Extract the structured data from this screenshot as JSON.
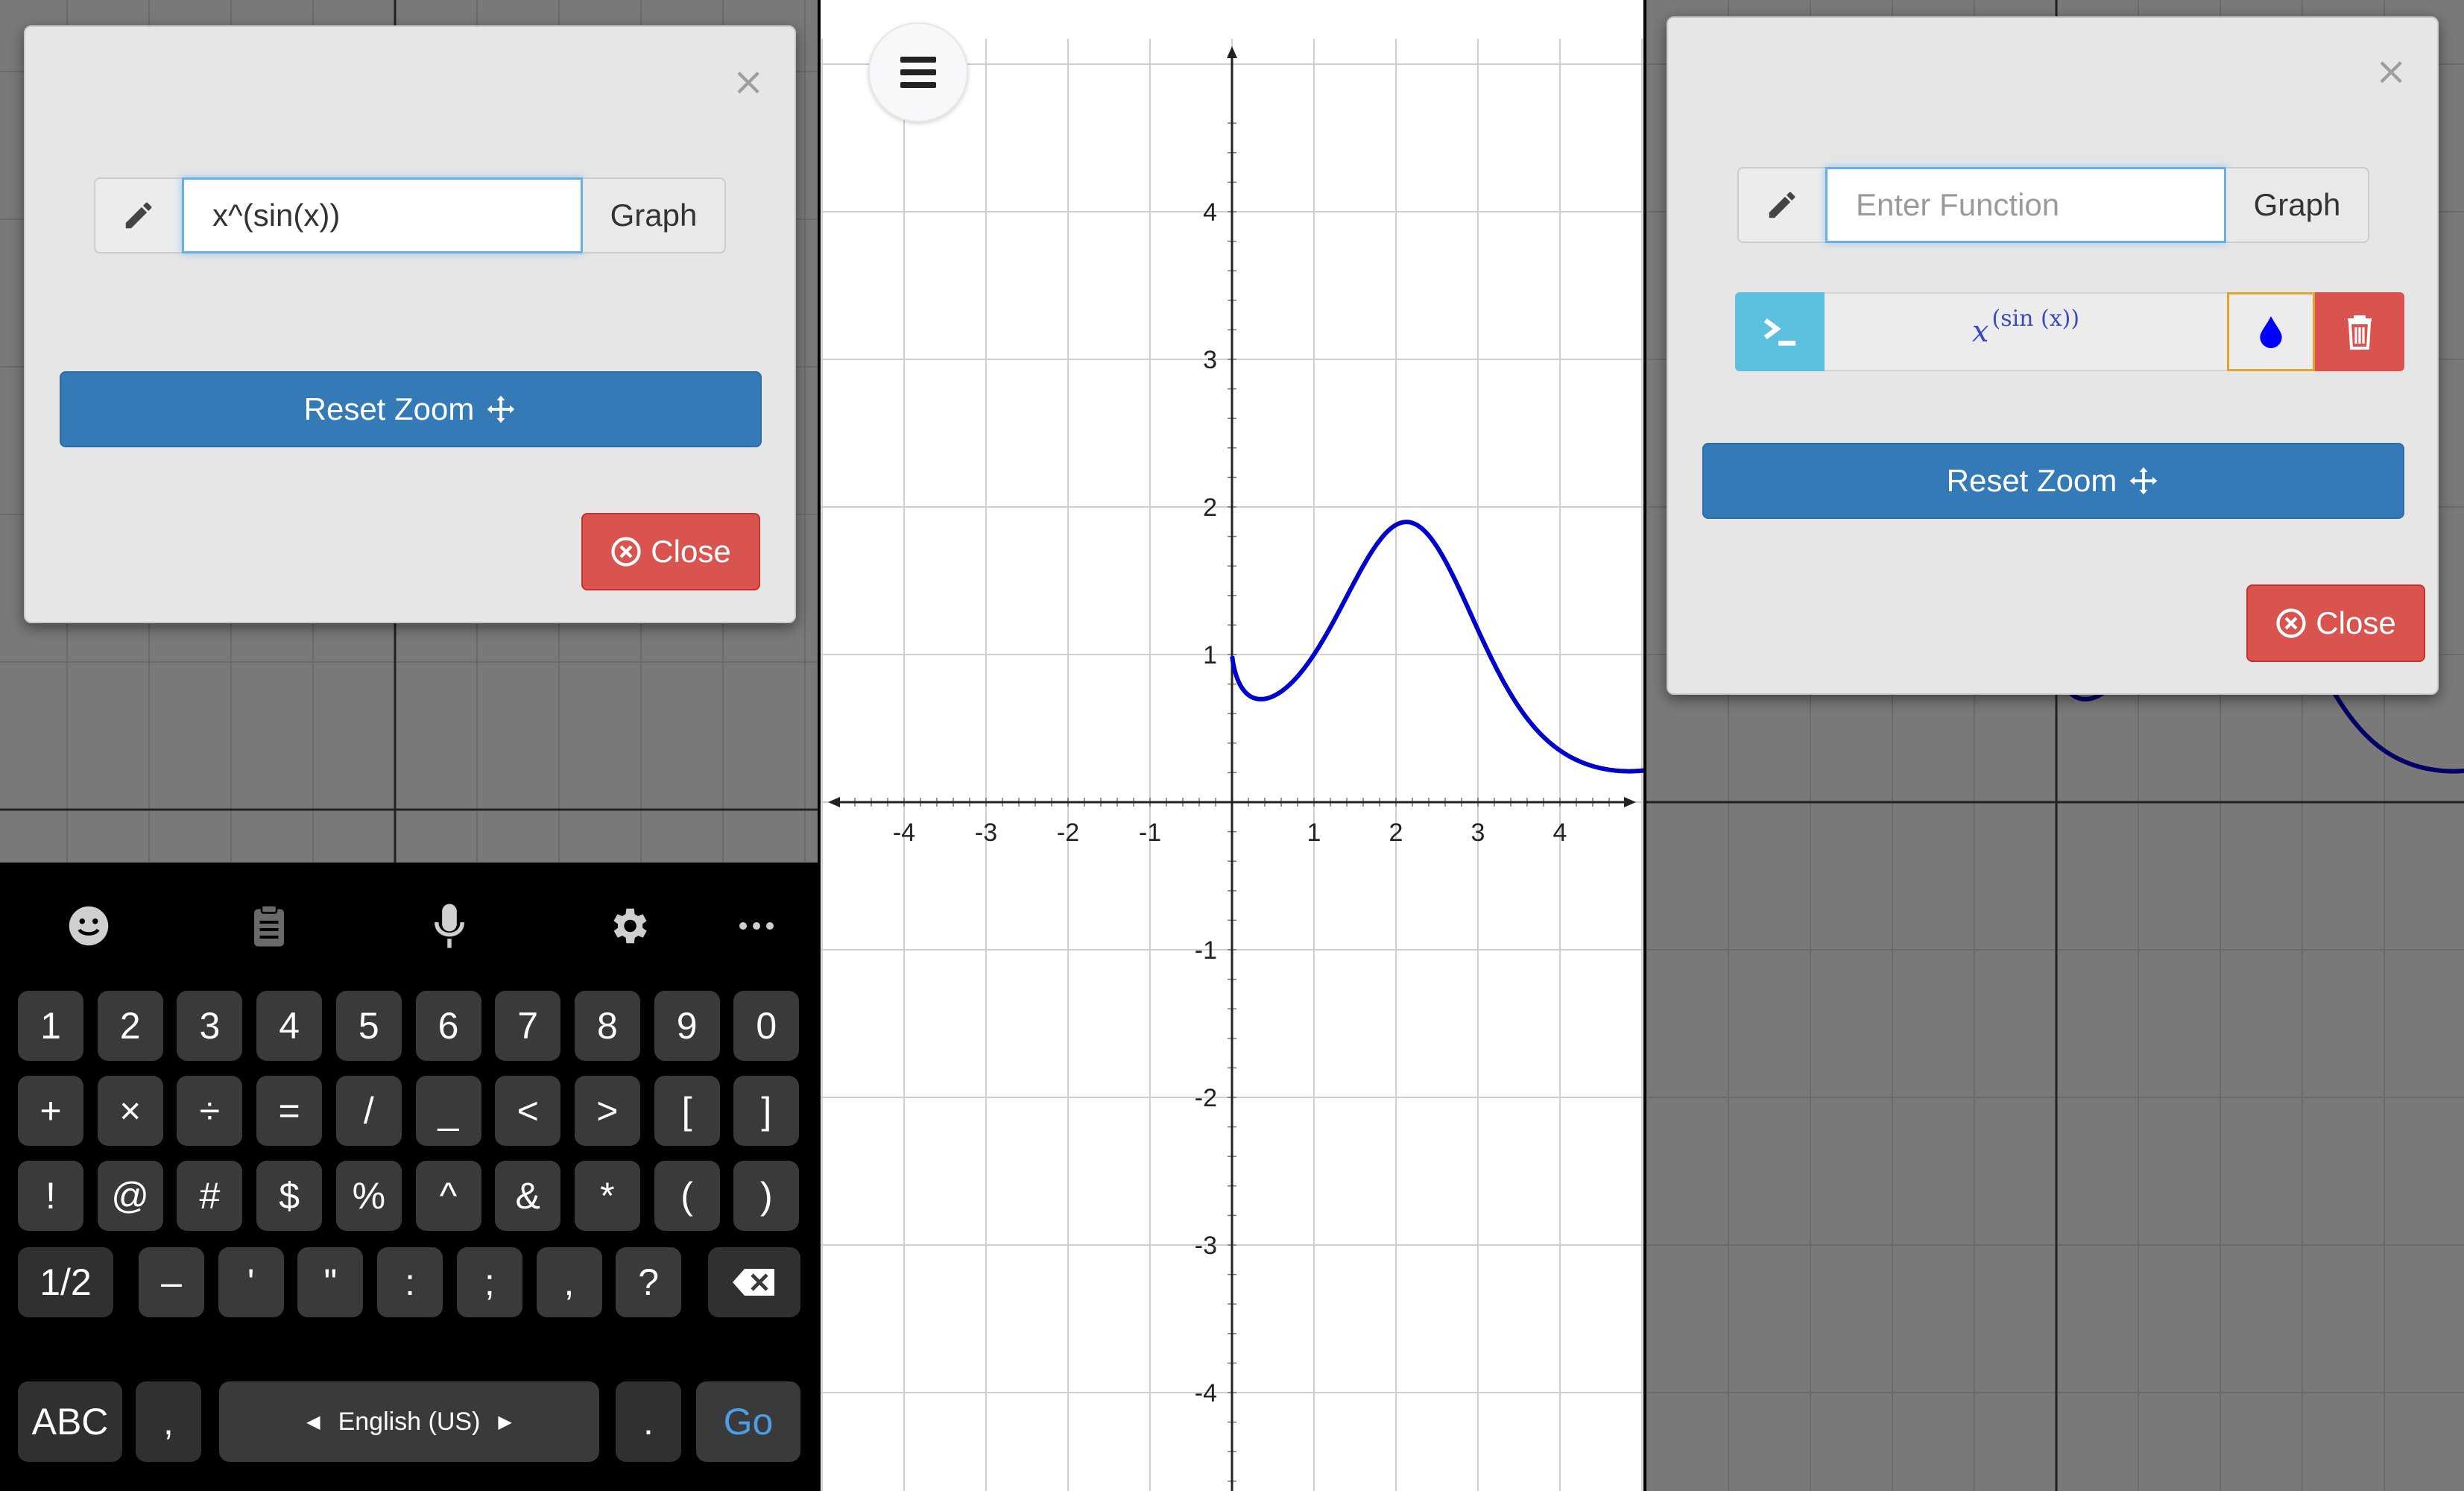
{
  "left_modal": {
    "close_x": "×",
    "function_input_value": "x^(sin(x))",
    "graph_button": "Graph",
    "reset_zoom": "Reset Zoom",
    "close_button": "Close"
  },
  "keyboard": {
    "toolbar_icons": [
      "emoji-icon",
      "clipboard-icon",
      "microphone-icon",
      "settings-gear-icon",
      "more-icon"
    ],
    "rows": [
      [
        "1",
        "2",
        "3",
        "4",
        "5",
        "6",
        "7",
        "8",
        "9",
        "0"
      ],
      [
        "+",
        "×",
        "÷",
        "=",
        "/",
        "_",
        "<",
        ">",
        "[",
        "]"
      ],
      [
        "!",
        "@",
        "#",
        "$",
        "%",
        "^",
        "&",
        "*",
        "(",
        ")"
      ],
      [
        "1/2",
        "–",
        "'",
        "\"",
        ":",
        ";",
        ",",
        "?"
      ]
    ],
    "bottom": {
      "abc": "ABC",
      "comma": ",",
      "space_label": "English (US)",
      "period": ".",
      "go": "Go"
    }
  },
  "graph": {
    "function": "x^(sin(x))",
    "curve_color": "#0000cc",
    "x_ticks": [
      "-4",
      "-3",
      "-2",
      "-1",
      "1",
      "2",
      "3",
      "4"
    ],
    "y_ticks": [
      "4",
      "3",
      "2",
      "1",
      "-1",
      "-2",
      "-3",
      "-4"
    ],
    "grid": true
  },
  "right_modal": {
    "close_x": "×",
    "function_input_placeholder": "Enter Function",
    "graph_button": "Graph",
    "function_entry": {
      "base": "x",
      "exponent": "(sin (x))",
      "color": "#0000ff"
    },
    "reset_zoom": "Reset Zoom",
    "close_button": "Close"
  },
  "colors": {
    "primary": "#337ab7",
    "danger": "#d9534f",
    "info": "#5bc0de",
    "curve": "#0000cc"
  }
}
